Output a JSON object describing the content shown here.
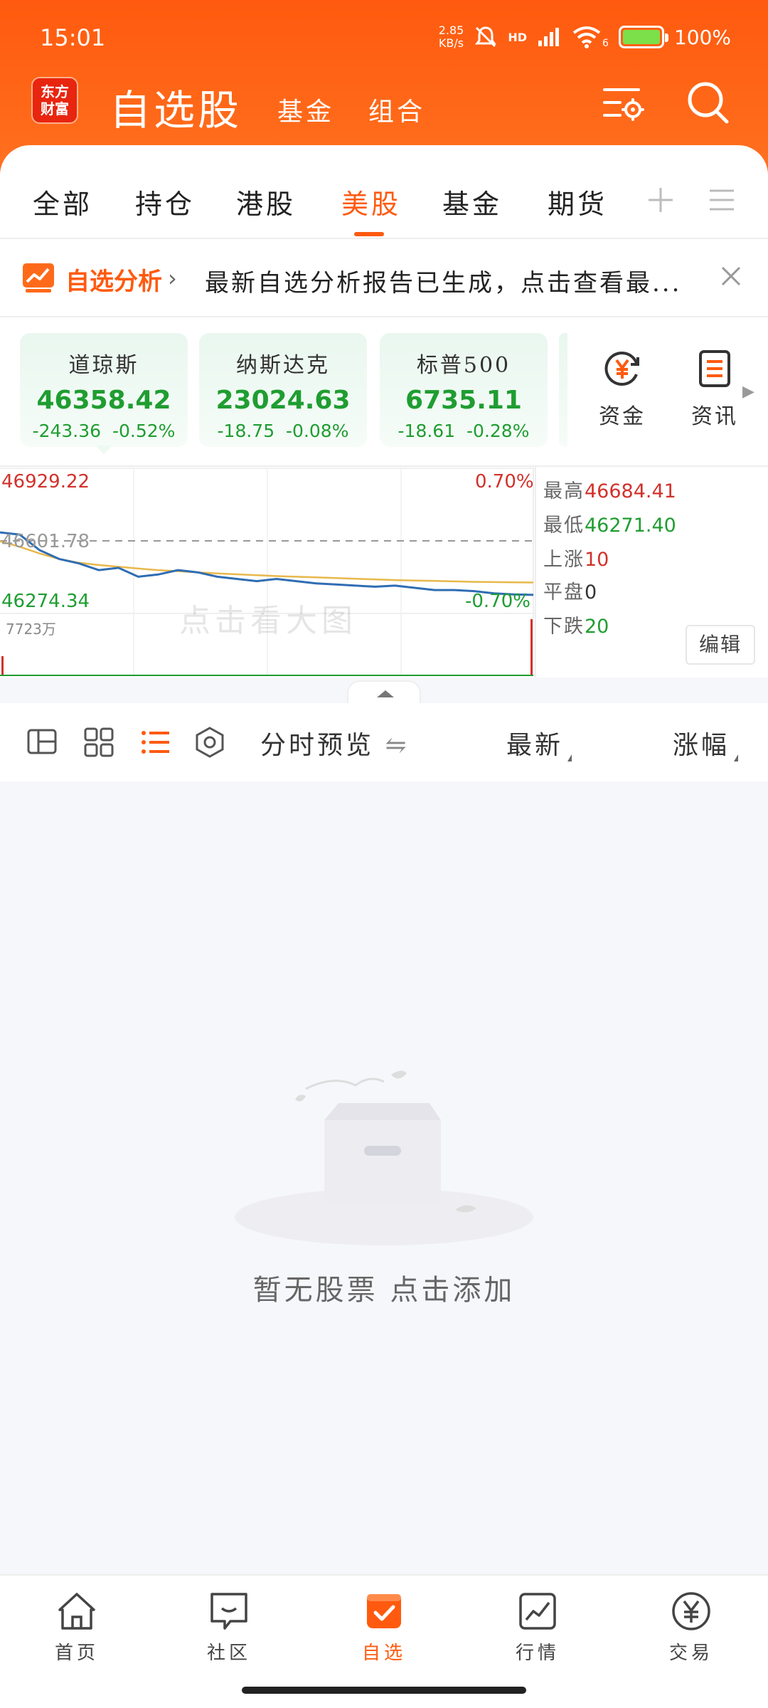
{
  "status_bar": {
    "time": "15:01",
    "net_speed_value": "2.85",
    "net_speed_unit": "KB/s",
    "network": "HD",
    "wifi_badge": "6",
    "battery": "100%"
  },
  "header": {
    "logo_line1": "东方",
    "logo_line2": "财富",
    "title": "自选股",
    "sub_tabs": [
      "基金",
      "组合"
    ],
    "icons": [
      "settings-icon",
      "search-icon"
    ]
  },
  "category_tabs": {
    "items": [
      "全部",
      "持仓",
      "港股",
      "美股",
      "基金",
      "期货"
    ],
    "active": "美股"
  },
  "banner": {
    "title": "自选分析",
    "text": "最新自选分析报告已生成，点击查看最..."
  },
  "indices": [
    {
      "name": "道琼斯",
      "price": "46358.42",
      "change": "-243.36",
      "change_pct": "-0.52%"
    },
    {
      "name": "纳斯达克",
      "price": "23024.63",
      "change": "-18.75",
      "change_pct": "-0.08%"
    },
    {
      "name": "标普500",
      "price": "6735.11",
      "change": "-18.61",
      "change_pct": "-0.28%"
    }
  ],
  "quick_buttons": [
    {
      "label": "资金",
      "icon": "capital-yen-icon"
    },
    {
      "label": "资讯",
      "icon": "news-doc-icon"
    }
  ],
  "chart": {
    "y_top": "46929.22",
    "y_mid": "46601.78",
    "y_bottom": "46274.34",
    "pct_top": "0.70%",
    "pct_bottom": "-0.70%",
    "volume_label": "7723万",
    "watermark": "点击看大图"
  },
  "chart_data": {
    "type": "line",
    "ylim": [
      46274.34,
      46929.22
    ],
    "reference": 46601.78,
    "series": [
      {
        "values": [
          46640,
          46630,
          46560,
          46520,
          46500,
          46470,
          46480,
          46440,
          46450,
          46470,
          46460,
          46440,
          46430,
          46420,
          46430,
          46420,
          46410,
          46405,
          46400,
          46395,
          46400,
          46390,
          46380,
          46380,
          46375,
          46365,
          46360,
          46358
        ]
      },
      {
        "values": [
          46600,
          46575,
          46545,
          46520,
          46503,
          46493,
          46485,
          46477,
          46470,
          46465,
          46460,
          46455,
          46451,
          46447,
          46443,
          46440,
          46437,
          46434,
          46431,
          46428,
          46425,
          46423,
          46421,
          46419,
          46417,
          46416,
          46415,
          46414
        ]
      }
    ]
  },
  "stats": {
    "high_label": "最高",
    "high_value": "46684.41",
    "low_label": "最低",
    "low_value": "46271.40",
    "up_label": "上涨",
    "up_value": "10",
    "flat_label": "平盘",
    "flat_value": "0",
    "down_label": "下跌",
    "down_value": "20",
    "edit_label": "编辑"
  },
  "toolbar": {
    "preview_label": "分时预览",
    "latest_label": "最新",
    "change_label": "涨幅"
  },
  "empty_state": {
    "text": "暂无股票 点击添加"
  },
  "bottom_nav": [
    {
      "label": "首页",
      "icon": "home-icon"
    },
    {
      "label": "社区",
      "icon": "community-icon"
    },
    {
      "label": "自选",
      "icon": "watchlist-icon"
    },
    {
      "label": "行情",
      "icon": "market-chart-icon"
    },
    {
      "label": "交易",
      "icon": "trade-yen-icon"
    }
  ],
  "colors": {
    "brand_orange": "#ff5a0f",
    "down_green": "#1f9d31",
    "up_red": "#d2312b",
    "index_line": "#2f6db3",
    "avg_line": "#e8b84a"
  }
}
